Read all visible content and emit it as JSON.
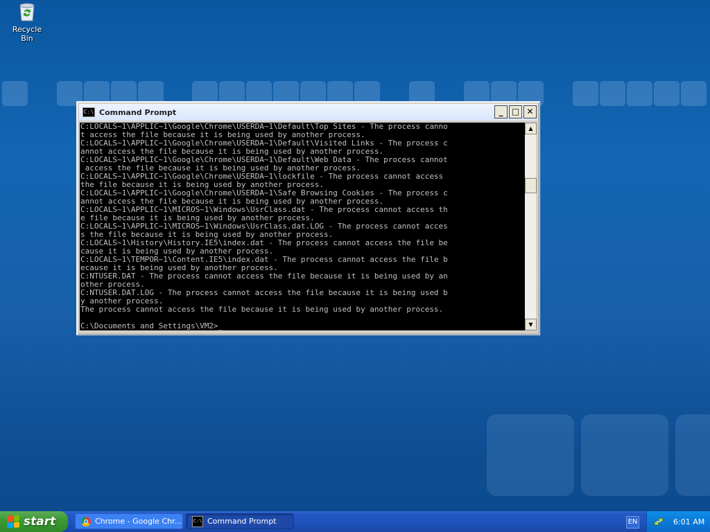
{
  "desktop": {
    "icons": [
      {
        "label": "Recycle Bin",
        "icon": "recycle-bin-icon"
      }
    ]
  },
  "cmd_window": {
    "title": "Command Prompt",
    "controls": {
      "minimize": "_",
      "maximize": "□",
      "close": "✕"
    },
    "console_lines": [
      "C:LOCALS~1\\APPLIC~1\\Google\\Chrome\\USERDA~1\\Default\\Top Sites - The process canno",
      "t access the file because it is being used by another process.",
      "C:LOCALS~1\\APPLIC~1\\Google\\Chrome\\USERDA~1\\Default\\Visited Links - The process c",
      "annot access the file because it is being used by another process.",
      "C:LOCALS~1\\APPLIC~1\\Google\\Chrome\\USERDA~1\\Default\\Web Data - The process cannot",
      " access the file because it is being used by another process.",
      "C:LOCALS~1\\APPLIC~1\\Google\\Chrome\\USERDA~1\\lockfile - The process cannot access",
      "the file because it is being used by another process.",
      "C:LOCALS~1\\APPLIC~1\\Google\\Chrome\\USERDA~1\\Safe Browsing Cookies - The process c",
      "annot access the file because it is being used by another process.",
      "C:LOCALS~1\\APPLIC~1\\MICROS~1\\Windows\\UsrClass.dat - The process cannot access th",
      "e file because it is being used by another process.",
      "C:LOCALS~1\\APPLIC~1\\MICROS~1\\Windows\\UsrClass.dat.LOG - The process cannot acces",
      "s the file because it is being used by another process.",
      "C:LOCALS~1\\History\\History.IE5\\index.dat - The process cannot access the file be",
      "cause it is being used by another process.",
      "C:LOCALS~1\\TEMPOR~1\\Content.IE5\\index.dat - The process cannot access the file b",
      "ecause it is being used by another process.",
      "C:NTUSER.DAT - The process cannot access the file because it is being used by an",
      "other process.",
      "C:NTUSER.DAT.LOG - The process cannot access the file because it is being used b",
      "y another process.",
      "The process cannot access the file because it is being used by another process.",
      "",
      "C:\\Documents and Settings\\VM2>_"
    ]
  },
  "taskbar": {
    "start_label": "start",
    "items": [
      {
        "label": "Chrome - Google Chr...",
        "icon": "chrome-icon",
        "active": false
      },
      {
        "label": "Command Prompt",
        "icon": "cmd-icon",
        "active": true
      }
    ],
    "language": "EN",
    "clock": "6:01 AM"
  },
  "colors": {
    "desktop": "#1466b3",
    "console_bg": "#000000",
    "console_text": "#c0c0c0",
    "taskbar": "#245dc6",
    "start_green": "#3c9a34",
    "tray": "#0c7ad9"
  }
}
